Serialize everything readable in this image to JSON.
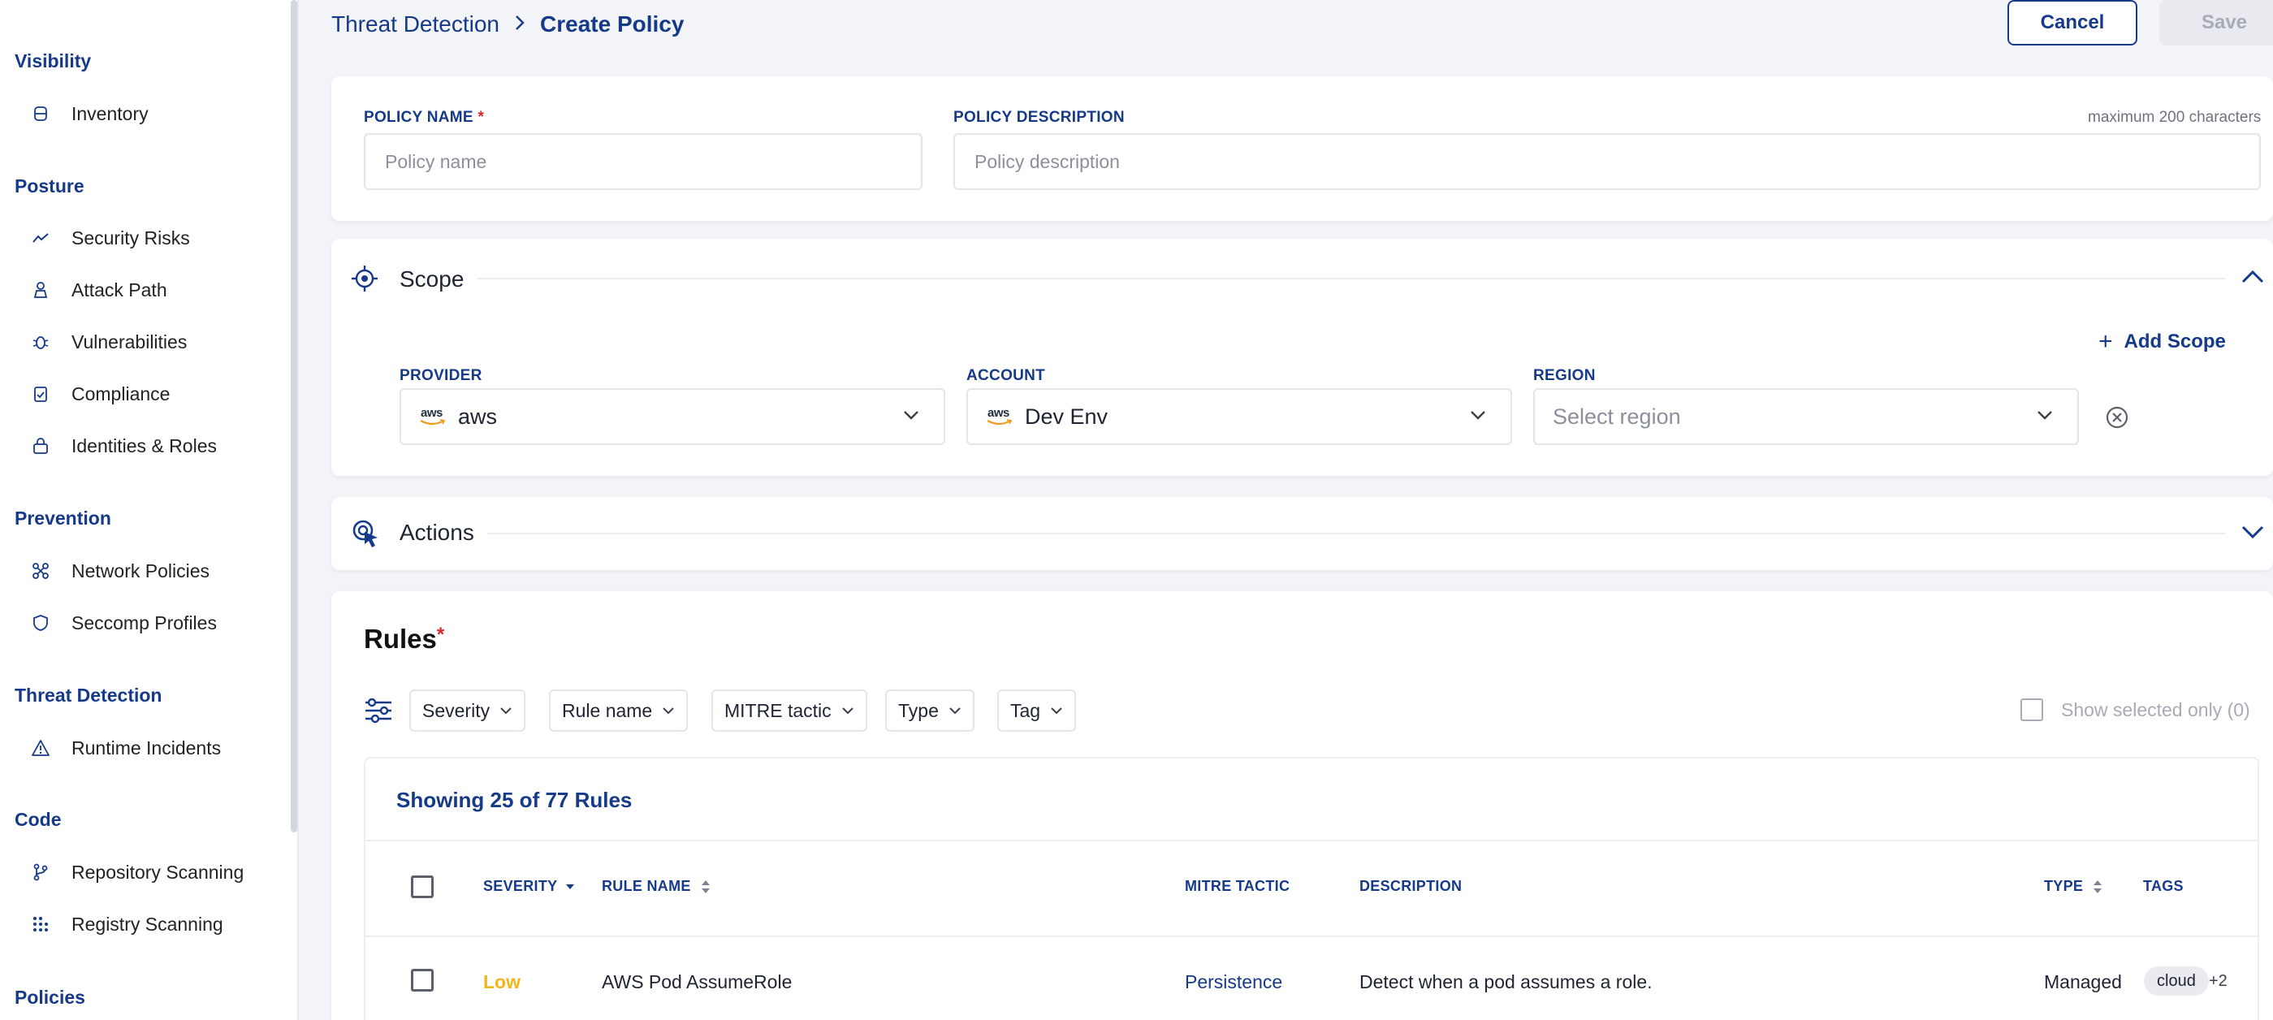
{
  "sidebar": {
    "sections": [
      {
        "title": "Visibility",
        "items": [
          {
            "label": "Inventory",
            "icon": "database-icon"
          }
        ]
      },
      {
        "title": "Posture",
        "items": [
          {
            "label": "Security Risks",
            "icon": "trend-line-icon"
          },
          {
            "label": "Attack Path",
            "icon": "attack-path-icon"
          },
          {
            "label": "Vulnerabilities",
            "icon": "bug-icon"
          },
          {
            "label": "Compliance",
            "icon": "checklist-icon"
          },
          {
            "label": "Identities & Roles",
            "icon": "lock-icon"
          }
        ]
      },
      {
        "title": "Prevention",
        "items": [
          {
            "label": "Network Policies",
            "icon": "network-icon"
          },
          {
            "label": "Seccomp Profiles",
            "icon": "shield-icon"
          }
        ]
      },
      {
        "title": "Threat Detection",
        "items": [
          {
            "label": "Runtime Incidents",
            "icon": "warning-icon"
          }
        ]
      },
      {
        "title": "Code",
        "items": [
          {
            "label": "Repository Scanning",
            "icon": "git-branch-icon"
          },
          {
            "label": "Registry Scanning",
            "icon": "grid-dots-icon"
          }
        ]
      },
      {
        "title": "Policies",
        "items": []
      }
    ]
  },
  "breadcrumb": {
    "parent": "Threat Detection",
    "separator": "›",
    "current": "Create Policy"
  },
  "header": {
    "cancel_label": "Cancel",
    "save_label": "Save"
  },
  "policy": {
    "name_label": "POLICY NAME",
    "required_mark": "*",
    "name_placeholder": "Policy name",
    "description_label": "POLICY DESCRIPTION",
    "description_hint": "maximum 200 characters",
    "description_placeholder": "Policy description"
  },
  "scope": {
    "title": "Scope",
    "add_scope_label": "Add Scope",
    "provider_label": "PROVIDER",
    "provider_value": "aws",
    "account_label": "ACCOUNT",
    "account_value": "Dev Env",
    "region_label": "REGION",
    "region_placeholder": "Select region",
    "aws_logo_text": "aws"
  },
  "actions": {
    "title": "Actions"
  },
  "rules": {
    "title": "Rules",
    "required_mark": "*",
    "filters": [
      "Severity",
      "Rule name",
      "MITRE tactic",
      "Type",
      "Tag"
    ],
    "show_selected_label": "Show selected only (0)",
    "showing_text": "Showing 25 of 77 Rules",
    "columns": {
      "severity": "SEVERITY",
      "rule_name": "RULE NAME",
      "mitre_tactic": "MITRE TACTIC",
      "description": "DESCRIPTION",
      "type": "TYPE",
      "tags": "TAGS"
    },
    "rows": [
      {
        "severity": "Low",
        "rule_name": "AWS Pod AssumeRole",
        "mitre_tactic": "Persistence",
        "description": "Detect when a pod assumes a role.",
        "type": "Managed",
        "tag": "cloud",
        "more_tags": "+2"
      }
    ]
  },
  "colors": {
    "brand": "#163a8a",
    "severity_low": "#f2b51c",
    "required": "#d9262c"
  }
}
